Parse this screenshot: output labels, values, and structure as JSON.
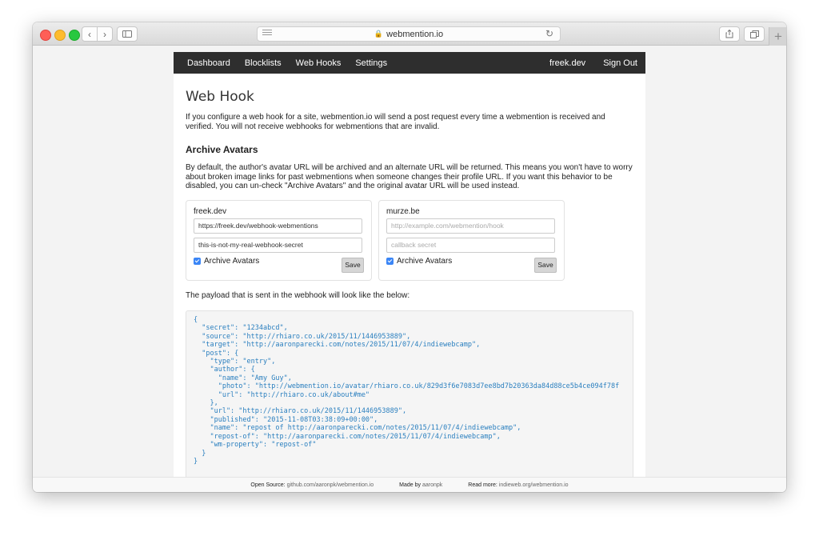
{
  "browser": {
    "url": "webmention.io"
  },
  "nav": {
    "dashboard": "Dashboard",
    "blocklists": "Blocklists",
    "webhooks": "Web Hooks",
    "settings": "Settings",
    "user": "freek.dev",
    "signout": "Sign Out"
  },
  "page": {
    "title": "Web Hook",
    "intro": "If you configure a web hook for a site, webmention.io will send a post request every time a webmention is received and verified. You will not receive webhooks for webmentions that are invalid.",
    "archive_heading": "Archive Avatars",
    "archive_text": "By default, the author's avatar URL will be archived and an alternate URL will be returned. This means you won't have to worry about broken image links for past webmentions when someone changes their profile URL. If you want this behavior to be disabled, you can un-check \"Archive Avatars\" and the original avatar URL will be used instead.",
    "payload_note": "The payload that is sent in the webhook will look like the below:"
  },
  "sites": [
    {
      "name": "freek.dev",
      "url_value": "https://freek.dev/webhook-webmentions",
      "url_placeholder": "http://example.com/webmention/hook",
      "secret_value": "this-is-not-my-real-webhook-secret",
      "secret_placeholder": "callback secret",
      "archive_label": "Archive Avatars",
      "archive_checked": true,
      "save_label": "Save"
    },
    {
      "name": "murze.be",
      "url_value": "",
      "url_placeholder": "http://example.com/webmention/hook",
      "secret_value": "",
      "secret_placeholder": "callback secret",
      "archive_label": "Archive Avatars",
      "archive_checked": true,
      "save_label": "Save"
    }
  ],
  "code": {
    "text": "{\n  \"secret\": \"1234abcd\",\n  \"source\": \"http://rhiaro.co.uk/2015/11/1446953889\",\n  \"target\": \"http://aaronparecki.com/notes/2015/11/07/4/indiewebcamp\",\n  \"post\": {\n    \"type\": \"entry\",\n    \"author\": {\n      \"name\": \"Amy Guy\",\n      \"photo\": \"http://webmention.io/avatar/rhiaro.co.uk/829d3f6e7083d7ee8bd7b20363da84d88ce5b4ce094f78f\n      \"url\": \"http://rhiaro.co.uk/about#me\"\n    },\n    \"url\": \"http://rhiaro.co.uk/2015/11/1446953889\",\n    \"published\": \"2015-11-08T03:38:09+00:00\",\n    \"name\": \"repost of http://aaronparecki.com/notes/2015/11/07/4/indiewebcamp\",\n    \"repost-of\": \"http://aaronparecki.com/notes/2015/11/07/4/indiewebcamp\",\n    \"wm-property\": \"repost-of\"\n  }\n}"
  },
  "footer": {
    "open_label": "Open Source:",
    "open_link": "github.com/aaronpk/webmention.io",
    "made_label": "Made by",
    "made_link": "aaronpk",
    "read_label": "Read more:",
    "read_link": "indieweb.org/webmention.io"
  },
  "colors": {
    "navbar": "#2e2e2e",
    "code_text": "#2a7fbf",
    "checkbox": "#3b86f6"
  }
}
